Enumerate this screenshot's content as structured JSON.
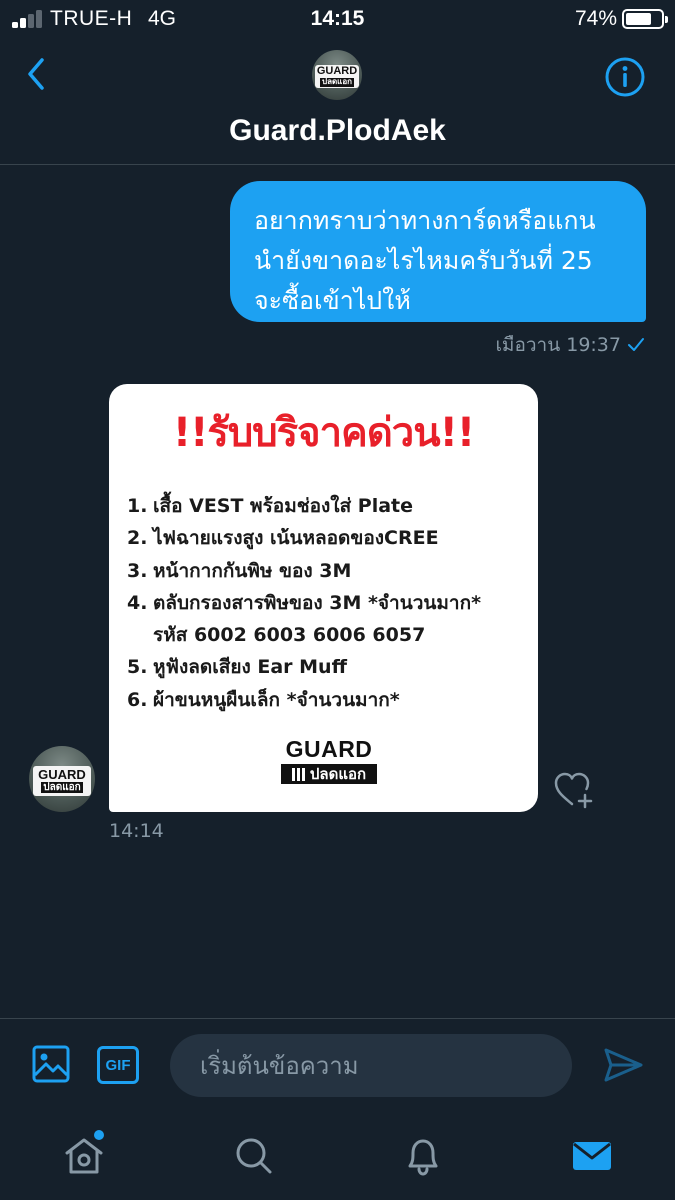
{
  "status_bar": {
    "carrier": "TRUE-H",
    "network": "4G",
    "time": "14:15",
    "battery_percent": "74%",
    "battery_level": 0.74,
    "signal_bars": 2
  },
  "header": {
    "title": "Guard.PlodAek",
    "back_icon": "chevron-left-icon",
    "info_icon": "info-icon"
  },
  "avatar": {
    "logo_line1": "GUARD",
    "logo_line2": "ปลดแอก"
  },
  "messages": {
    "sent": {
      "lines": [
        "อยากทราบว่าทางการ์ดหรือแกน",
        "นำยังขาดอะไรไหมครับวันที่ 25",
        "จะซื้อเข้าไปให้"
      ],
      "timestamp": "เมือวาน 19:37",
      "status_icon": "check-icon"
    },
    "received": {
      "image": {
        "headline": "!!รับบริจาคด่วน!!",
        "items": [
          {
            "num": "1.",
            "text": "เสื้อ VEST พร้อมช่องใส่ Plate"
          },
          {
            "num": "2.",
            "text": "ไฟฉายแรงสูง เน้นหลอดของCREE"
          },
          {
            "num": "3.",
            "text": "หน้ากากกันพิษ ของ 3M"
          },
          {
            "num": "4.",
            "text": "ตลับกรองสารพิษของ 3M *จำนวนมาก*"
          },
          {
            "num": "",
            "text": "รหัส 6002 6003 6006 6057"
          },
          {
            "num": "5.",
            "text": "หูฟังลดเสียง Ear Muff"
          },
          {
            "num": "6.",
            "text": "ผ้าขนหนูผืนเล็ก *จำนวนมาก*"
          }
        ],
        "logo_line1": "GUARD",
        "logo_line2": "ปลดแอก"
      },
      "timestamp": "14:14",
      "like_icon": "heart-plus-icon"
    }
  },
  "composer": {
    "placeholder": "เริ่มต้นข้อความ",
    "gif_label": "GIF",
    "media_icon": "image-icon",
    "send_icon": "send-icon"
  },
  "tab_bar": {
    "items": [
      "home-icon",
      "search-icon",
      "bell-icon",
      "mail-icon"
    ],
    "active": "mail-icon"
  },
  "colors": {
    "background": "#15202b",
    "accent": "#1da1f2",
    "muted": "#8899a6",
    "divider": "#38444d",
    "headline_red": "#e8202a"
  }
}
